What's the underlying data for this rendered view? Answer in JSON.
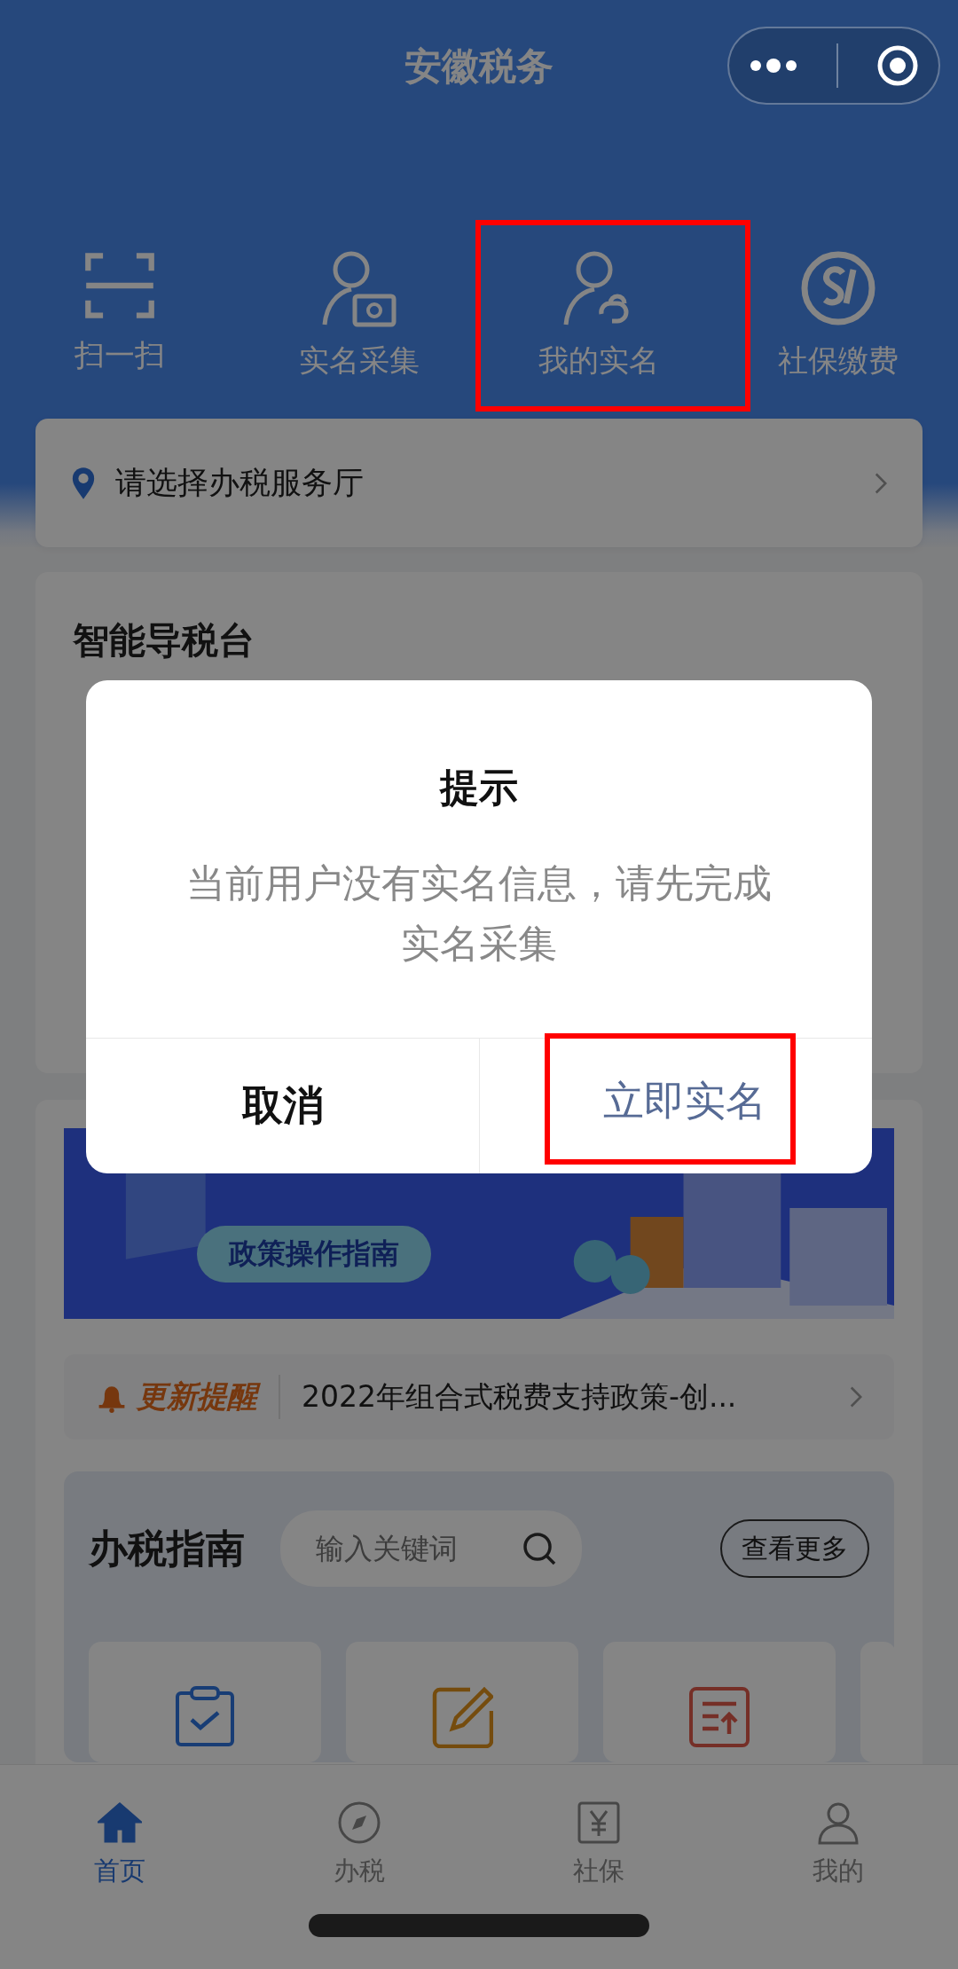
{
  "nav_bar": {
    "title": "安徽税务"
  },
  "quick_actions": [
    {
      "kind": "scan",
      "label": "扫一扫",
      "highlighted": false
    },
    {
      "kind": "camera",
      "label": "实名采集",
      "highlighted": false
    },
    {
      "kind": "identity",
      "label": "我的实名",
      "highlighted": true
    },
    {
      "kind": "social",
      "label": "社保缴费",
      "highlighted": false
    }
  ],
  "location_bar": {
    "placeholder": "请选择办税服务厅"
  },
  "guide_card": {
    "title": "智能导税台"
  },
  "banner": {
    "button": "政策操作指南"
  },
  "notice_bar": {
    "tag": "更新提醒",
    "text": "2022年组合式税费支持政策-创..."
  },
  "tax_guide": {
    "title": "办税指南",
    "search": {
      "placeholder": "输入关键词"
    },
    "more_button": "查看更多",
    "tiles": [
      {
        "kind": "clipboard"
      },
      {
        "kind": "edit"
      },
      {
        "kind": "upload"
      }
    ]
  },
  "tab_bar": [
    {
      "kind": "home",
      "label": "首页",
      "selected": true
    },
    {
      "kind": "compass",
      "label": "办税",
      "selected": false
    },
    {
      "kind": "yuan",
      "label": "社保",
      "selected": false
    },
    {
      "kind": "user",
      "label": "我的",
      "selected": false
    }
  ],
  "dialog": {
    "title": "提示",
    "message": "当前用户没有实名信息，请先完成实名采集",
    "buttons": [
      {
        "kind": "cancel",
        "label": "取消",
        "highlighted": false
      },
      {
        "kind": "confirm",
        "label": "立即实名",
        "highlighted": true
      }
    ]
  }
}
